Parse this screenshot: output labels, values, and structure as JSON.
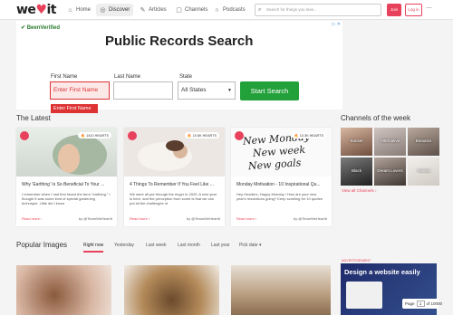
{
  "header": {
    "logo": {
      "pre": "we",
      "heart": "♥",
      "post": "it"
    },
    "nav": [
      {
        "label": "Home",
        "icon": "home-icon"
      },
      {
        "label": "Discover",
        "icon": "compass-icon"
      },
      {
        "label": "Articles",
        "icon": "pencil-icon"
      },
      {
        "label": "Channels",
        "icon": "channels-icon"
      },
      {
        "label": "Podcasts",
        "icon": "headphones-icon"
      }
    ],
    "search_placeholder": "Search for things you love...",
    "join": "Join",
    "login": "Log in",
    "more": "⋯"
  },
  "ad": {
    "brand": "BeenVerified",
    "close": "▷ ✕",
    "title": "Public Records Search",
    "first_label": "First Name",
    "first_value": "Enter First Name",
    "last_label": "Last Name",
    "state_label": "State",
    "state_value": "All States",
    "button": "Start Search",
    "error": "Enter First Name"
  },
  "latest": {
    "heading": "The Latest",
    "cards": [
      {
        "hearts": "🔥 1410 HEARTS",
        "title": "Why 'Earthing' Is So Beneficial To Your ...",
        "desc": "I remember when I had first heard the term \"earthing.\" I thought it was some kind of special gardening technique. Little did I know",
        "read": "Read more ›",
        "by": "by @TeamWeHeartIt"
      },
      {
        "hearts": "🔥 10.6K HEARTS",
        "title": "4 Things To Remember If You Feel Like ...",
        "desc": "We were all put through the ringer in 2020. A new year is here, and the perception from some is that we can put all the challenges of",
        "read": "Read more ›",
        "by": "by @TeamWeHeartIt"
      },
      {
        "hearts": "🔥 13.3K HEARTS",
        "title": "Monday Motivation - 10 Inspirational Qu...",
        "desc": "Hey Hearters, Happy Monday ! How are your new year's resolutions going? Keep scrolling for 10 quotes",
        "read": "Read more ›",
        "by": "by @TeamWeHeartIt"
      }
    ],
    "card_script": [
      "New Monday",
      "New week",
      "New goals"
    ]
  },
  "channels": {
    "heading": "Channels of the week",
    "items": [
      "Sunset",
      "Alternative",
      "Beauties",
      "Black",
      "Dream Lovers",
      "Articles"
    ],
    "view_all": "View all Channels ›"
  },
  "popular": {
    "heading": "Popular Images",
    "tabs": [
      "Right now",
      "Yesterday",
      "Last week",
      "Last month",
      "Last year",
      "Pick date ▾"
    ],
    "advert_label": "ADVERTISEMENT",
    "advert_text": "Design a website easily",
    "pager": {
      "label": "Page",
      "value": "1",
      "total": "of 10000"
    }
  },
  "colors": {
    "accent": "#e8415b",
    "green": "#22a03a"
  }
}
